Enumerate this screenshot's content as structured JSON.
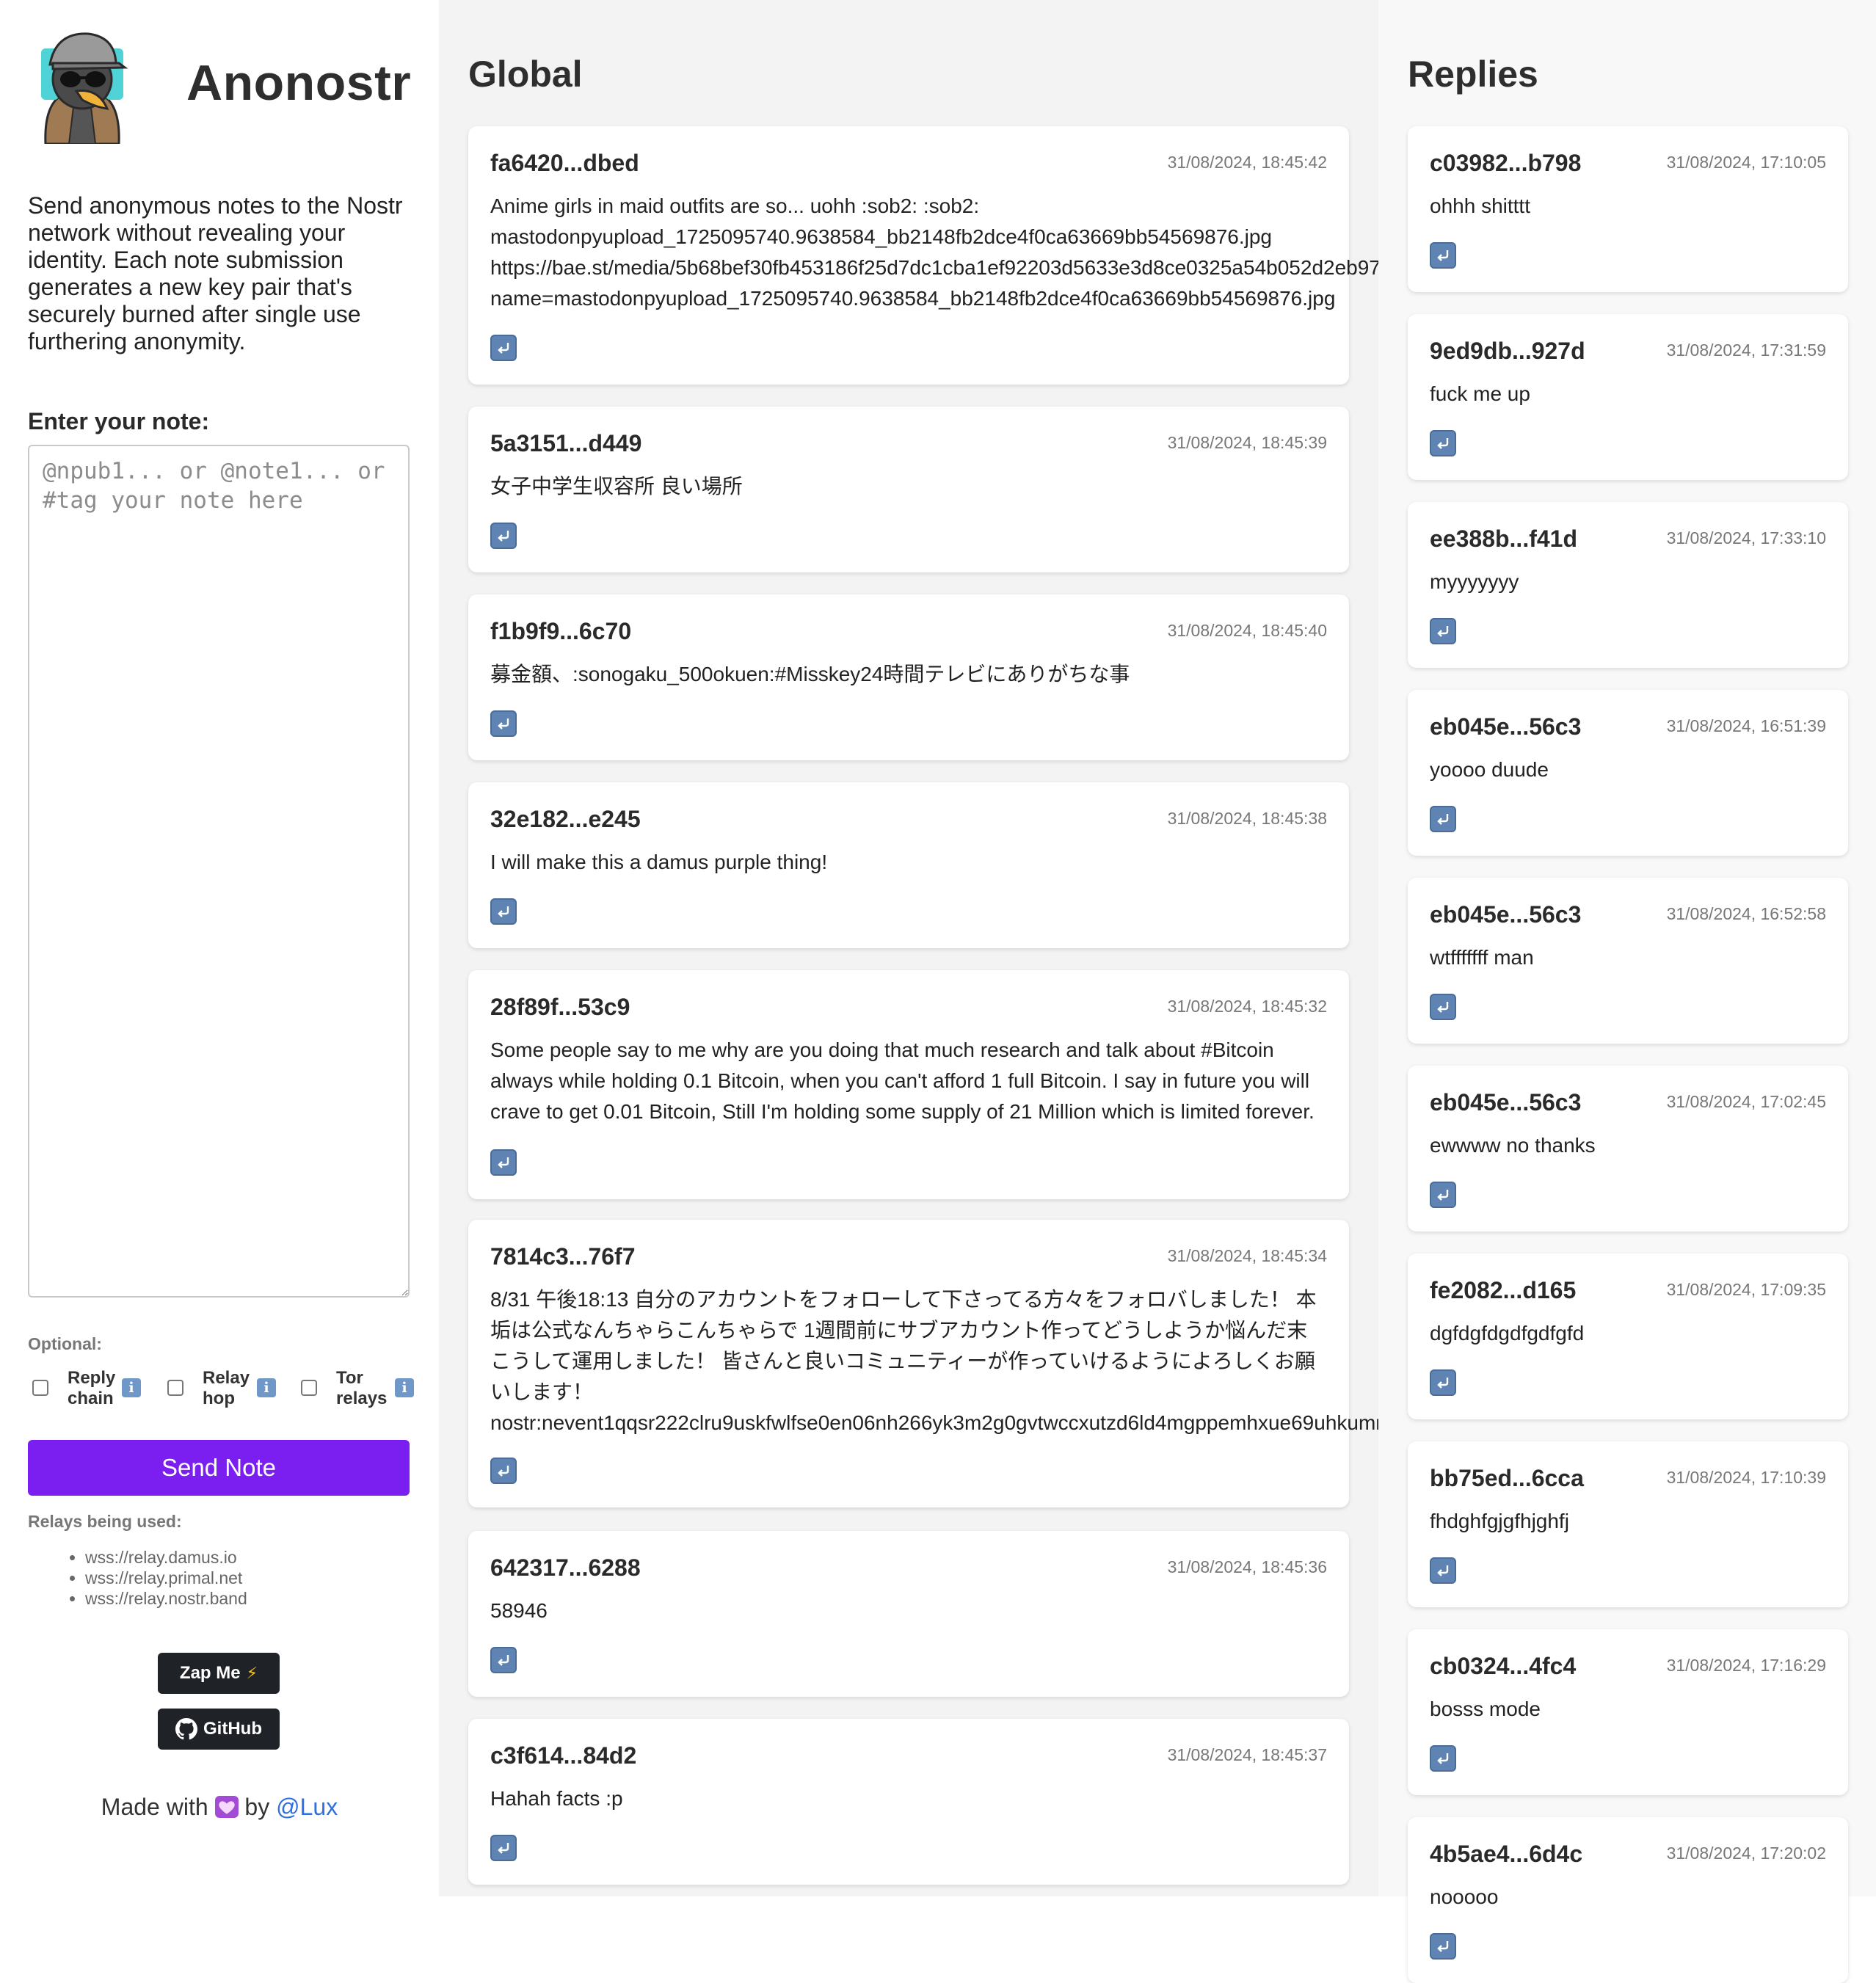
{
  "sidebar": {
    "app_title": "Anonostr",
    "intro": "Send anonymous notes to the Nostr network without revealing your identity. Each note submission generates a new key pair that's securely burned after single use furthering anonymity.",
    "note_label": "Enter your note:",
    "note_placeholder": "@npub1... or @note1... or #tag your note here",
    "optional_label": "Optional:",
    "options": [
      {
        "label": "Reply chain",
        "info": "i"
      },
      {
        "label": "Relay hop",
        "info": "i"
      },
      {
        "label": "Tor relays",
        "info": "i"
      }
    ],
    "send_label": "Send Note",
    "relays_label": "Relays being used:",
    "relays": [
      "wss://relay.damus.io",
      "wss://relay.primal.net",
      "wss://relay.nostr.band"
    ],
    "zap_label": "Zap Me",
    "github_label": "GitHub",
    "footer": {
      "made_with": "Made with",
      "by": "by",
      "author": "@Lux"
    }
  },
  "global": {
    "title": "Global",
    "notes": [
      {
        "pubkey": "fa6420...dbed",
        "time": "31/08/2024, 18:45:42",
        "content": "Anime girls in maid outfits are so... uohh :sob2: :sob2:\nmastodonpyupload_1725095740.9638584_bb2148fb2dce4f0ca63669bb54569876.jpg\nhttps://bae.st/media/5b68bef30fb453186f25d7dc1cba1ef92203d5633e3d8ce0325a54b052d2eb97\nname=mastodonpyupload_1725095740.9638584_bb2148fb2dce4f0ca63669bb54569876.jpg"
      },
      {
        "pubkey": "5a3151...d449",
        "time": "31/08/2024, 18:45:39",
        "content": "女子中学生収容所 良い場所"
      },
      {
        "pubkey": "f1b9f9...6c70",
        "time": "31/08/2024, 18:45:40",
        "content": "募金額、:sonogaku_500okuen:#Misskey24時間テレビにありがちな事"
      },
      {
        "pubkey": "32e182...e245",
        "time": "31/08/2024, 18:45:38",
        "content": "I will make this a damus purple thing!"
      },
      {
        "pubkey": "28f89f...53c9",
        "time": "31/08/2024, 18:45:32",
        "content": "Some people say to me why are you doing that much research and talk about #Bitcoin\nalways while holding 0.1 Bitcoin, when you can't afford 1 full Bitcoin. I say in future you will\ncrave to get 0.01 Bitcoin, Still I'm holding some supply of 21 Million which is limited forever."
      },
      {
        "pubkey": "7814c3...76f7",
        "time": "31/08/2024, 18:45:34",
        "content": "8/31 午後18:13 自分のアカウントをフォローして下さってる方々をフォロバしました！ 本\n垢は公式なんちゃらこんちゃらで 1週間前にサブアカウント作ってどうしようか悩んだ末\nこうして運用しました！ 皆さんと良いコミュニティーが作っていけるようによろしくお願\nいします！\nnostr:nevent1qqsr222clru9uskfwlfse0en06nh266yk3m2g0gvtwccxutzd6ld4mgppemhxue69uhkumm"
      },
      {
        "pubkey": "642317...6288",
        "time": "31/08/2024, 18:45:36",
        "content": "58946"
      },
      {
        "pubkey": "c3f614...84d2",
        "time": "31/08/2024, 18:45:37",
        "content": "Hahah facts :p"
      }
    ]
  },
  "replies": {
    "title": "Replies",
    "notes": [
      {
        "pubkey": "c03982...b798",
        "time": "31/08/2024, 17:10:05",
        "content": "ohhh shitttt"
      },
      {
        "pubkey": "9ed9db...927d",
        "time": "31/08/2024, 17:31:59",
        "content": "fuck me up"
      },
      {
        "pubkey": "ee388b...f41d",
        "time": "31/08/2024, 17:33:10",
        "content": "myyyyyyy"
      },
      {
        "pubkey": "eb045e...56c3",
        "time": "31/08/2024, 16:51:39",
        "content": "yoooo duude"
      },
      {
        "pubkey": "eb045e...56c3",
        "time": "31/08/2024, 16:52:58",
        "content": "wtfffffff man"
      },
      {
        "pubkey": "eb045e...56c3",
        "time": "31/08/2024, 17:02:45",
        "content": "ewwww no thanks"
      },
      {
        "pubkey": "fe2082...d165",
        "time": "31/08/2024, 17:09:35",
        "content": "dgfdgfdgdfgdfgfd"
      },
      {
        "pubkey": "bb75ed...6cca",
        "time": "31/08/2024, 17:10:39",
        "content": "fhdghfgjgfhjghfj"
      },
      {
        "pubkey": "cb0324...4fc4",
        "time": "31/08/2024, 17:16:29",
        "content": "bosss mode"
      },
      {
        "pubkey": "4b5ae4...6d4c",
        "time": "31/08/2024, 17:20:02",
        "content": "nooooo"
      }
    ]
  },
  "icons": {
    "reply": "reply-arrow-icon",
    "info": "info-icon",
    "zap": "lightning-bolt-icon",
    "github": "github-icon",
    "heart": "purple-heart-icon",
    "logo": "anonymous-bird-logo"
  },
  "colors": {
    "accent": "#7a1ff0",
    "reply_icon": "#5f84b3",
    "info_icon": "#6f98c9",
    "link": "#2f6fe0",
    "dark_button": "#1f2328"
  }
}
